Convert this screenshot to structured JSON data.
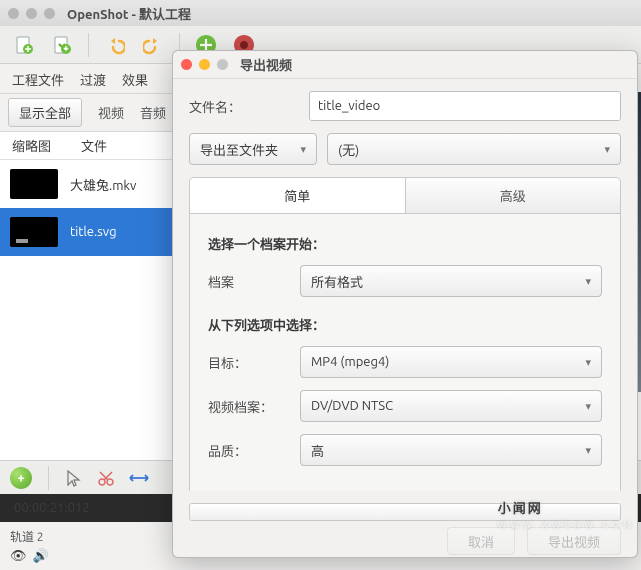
{
  "window": {
    "title": "OpenShot - 默认工程"
  },
  "panel": {
    "tabs": [
      "工程文件",
      "过渡",
      "效果"
    ],
    "filter_all": "显示全部",
    "filter_video": "视频",
    "filter_audio": "音频",
    "col_thumb": "缩略图",
    "col_file": "文件"
  },
  "files": [
    {
      "name": "大雄兔.mkv",
      "selected": false,
      "type": "video"
    },
    {
      "name": "title.svg",
      "selected": true,
      "type": "svg"
    }
  ],
  "timeline": {
    "timecode": "00:00:21:012",
    "track_name": "轨道 2"
  },
  "dialog": {
    "title": "导出视频",
    "label_filename": "文件名：",
    "filename_value": "title_video",
    "dd_export_to": "导出至文件夹",
    "dd_folder": "(无)",
    "tab_simple": "简单",
    "tab_advanced": "高级",
    "section1": "选择一个档案开始：",
    "label_profile": "档案",
    "profile_value": "所有格式",
    "section2": "从下列选项中选择：",
    "label_target": "目标：",
    "target_value": "MP4 (mpeg4)",
    "label_video_profile": "视频档案：",
    "video_profile_value": "DV/DVD NTSC",
    "label_quality": "品质：",
    "quality_value": "高",
    "btn_cancel": "取消",
    "btn_export": "导出视频"
  },
  "watermark": {
    "text": "小闻网",
    "sub": "WWW.XWENW.COM"
  }
}
